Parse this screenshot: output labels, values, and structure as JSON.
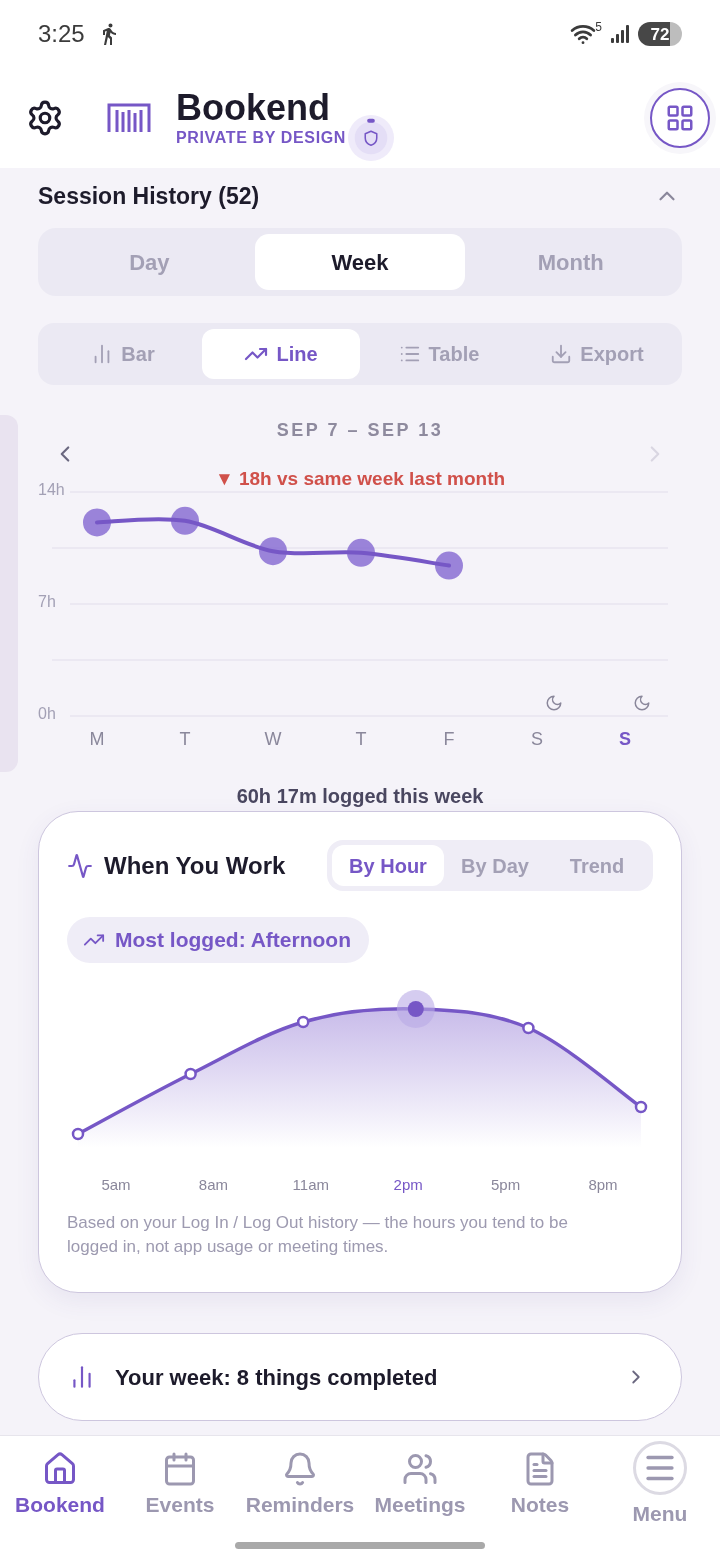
{
  "status_bar": {
    "time": "3:25",
    "wifi_label": "5",
    "battery": "72"
  },
  "header": {
    "title": "Bookend",
    "subtitle": "PRIVATE BY DESIGN"
  },
  "session_history": {
    "title": "Session History (52)",
    "expanded": true,
    "periods": [
      {
        "label": "Day",
        "selected": false
      },
      {
        "label": "Week",
        "selected": true
      },
      {
        "label": "Month",
        "selected": false
      }
    ],
    "views": [
      {
        "label": "Bar",
        "kind": "bar",
        "selected": false
      },
      {
        "label": "Line",
        "kind": "line",
        "selected": true
      },
      {
        "label": "Table",
        "kind": "table",
        "selected": false
      },
      {
        "label": "Export",
        "kind": "export",
        "selected": false
      }
    ],
    "range": "SEP 7 – SEP 13",
    "prev_disabled": false,
    "next_disabled": true,
    "comparison": "▼ 18h vs same week last month",
    "chart_data": {
      "type": "line",
      "marker": "o",
      "categories": [
        "M",
        "T",
        "W",
        "T",
        "F",
        "S",
        "S"
      ],
      "values": [
        12.1,
        12.2,
        10.3,
        10.2,
        9.4,
        null,
        null
      ],
      "ylim": [
        0,
        14
      ],
      "yticks": [
        {
          "value": 0,
          "label": "0h"
        },
        {
          "value": 7,
          "label": "7h"
        },
        {
          "value": 14,
          "label": "14h"
        }
      ]
    },
    "days": [
      {
        "moon": false,
        "selected": false
      },
      {
        "moon": false,
        "selected": false
      },
      {
        "moon": false,
        "selected": false
      },
      {
        "moon": false,
        "selected": false
      },
      {
        "moon": false,
        "selected": false
      },
      {
        "moon": true,
        "selected": false
      },
      {
        "moon": true,
        "selected": true
      }
    ],
    "total": "60h 17m logged this week"
  },
  "when_you_work": {
    "title": "When You Work",
    "modes": [
      {
        "label": "By Hour",
        "selected": true
      },
      {
        "label": "By Day",
        "selected": false
      },
      {
        "label": "Trend",
        "selected": false
      }
    ],
    "highlight": "Most logged: Afternoon",
    "hours": [
      {
        "label": "5am",
        "selected": false
      },
      {
        "label": "8am",
        "selected": false
      },
      {
        "label": "11am",
        "selected": false
      },
      {
        "label": "2pm",
        "selected": true
      },
      {
        "label": "5pm",
        "selected": false
      },
      {
        "label": "8pm",
        "selected": false
      }
    ],
    "note": "Based on your Log In / Log Out history — the hours you tend to be logged in, not app usage or meeting times."
  },
  "weekly_summary": {
    "text": "Your week: 8 things completed"
  },
  "bottom_nav": [
    {
      "label": "Bookend",
      "kind": "home",
      "selected": true
    },
    {
      "label": "Events",
      "kind": "events",
      "selected": false
    },
    {
      "label": "Reminders",
      "kind": "reminders",
      "selected": false
    },
    {
      "label": "Meetings",
      "kind": "meetings",
      "selected": false
    },
    {
      "label": "Notes",
      "kind": "notes",
      "selected": false
    },
    {
      "label": "Menu",
      "kind": "menu",
      "selected": false
    }
  ]
}
